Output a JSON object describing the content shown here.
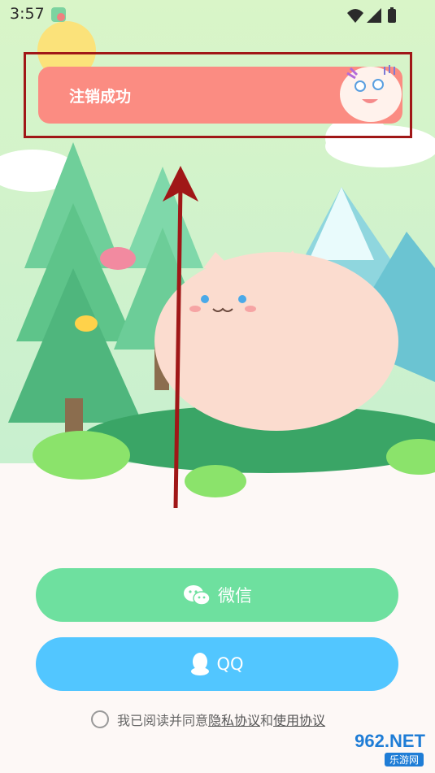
{
  "status_bar": {
    "time": "3:57",
    "icons": [
      "app-notification-icon",
      "wifi-icon",
      "signal-icon",
      "battery-charging-icon"
    ]
  },
  "toast": {
    "message": "注销成功",
    "mascot_icon": "mascot-face-icon"
  },
  "login": {
    "wechat_label": "微信",
    "wechat_icon": "wechat-icon",
    "qq_label": "QQ",
    "qq_icon": "qq-penguin-icon",
    "wechat_color": "#6ee09f",
    "qq_color": "#52c6ff"
  },
  "agreement": {
    "prefix": "我已阅读并同意",
    "privacy": "隐私协议",
    "joiner": "和",
    "terms": "使用协议"
  },
  "annotation": {
    "frame_color": "#a01717",
    "arrow_color": "#a01717"
  },
  "watermark": {
    "brand": "962.NET",
    "sub": "乐游网"
  }
}
